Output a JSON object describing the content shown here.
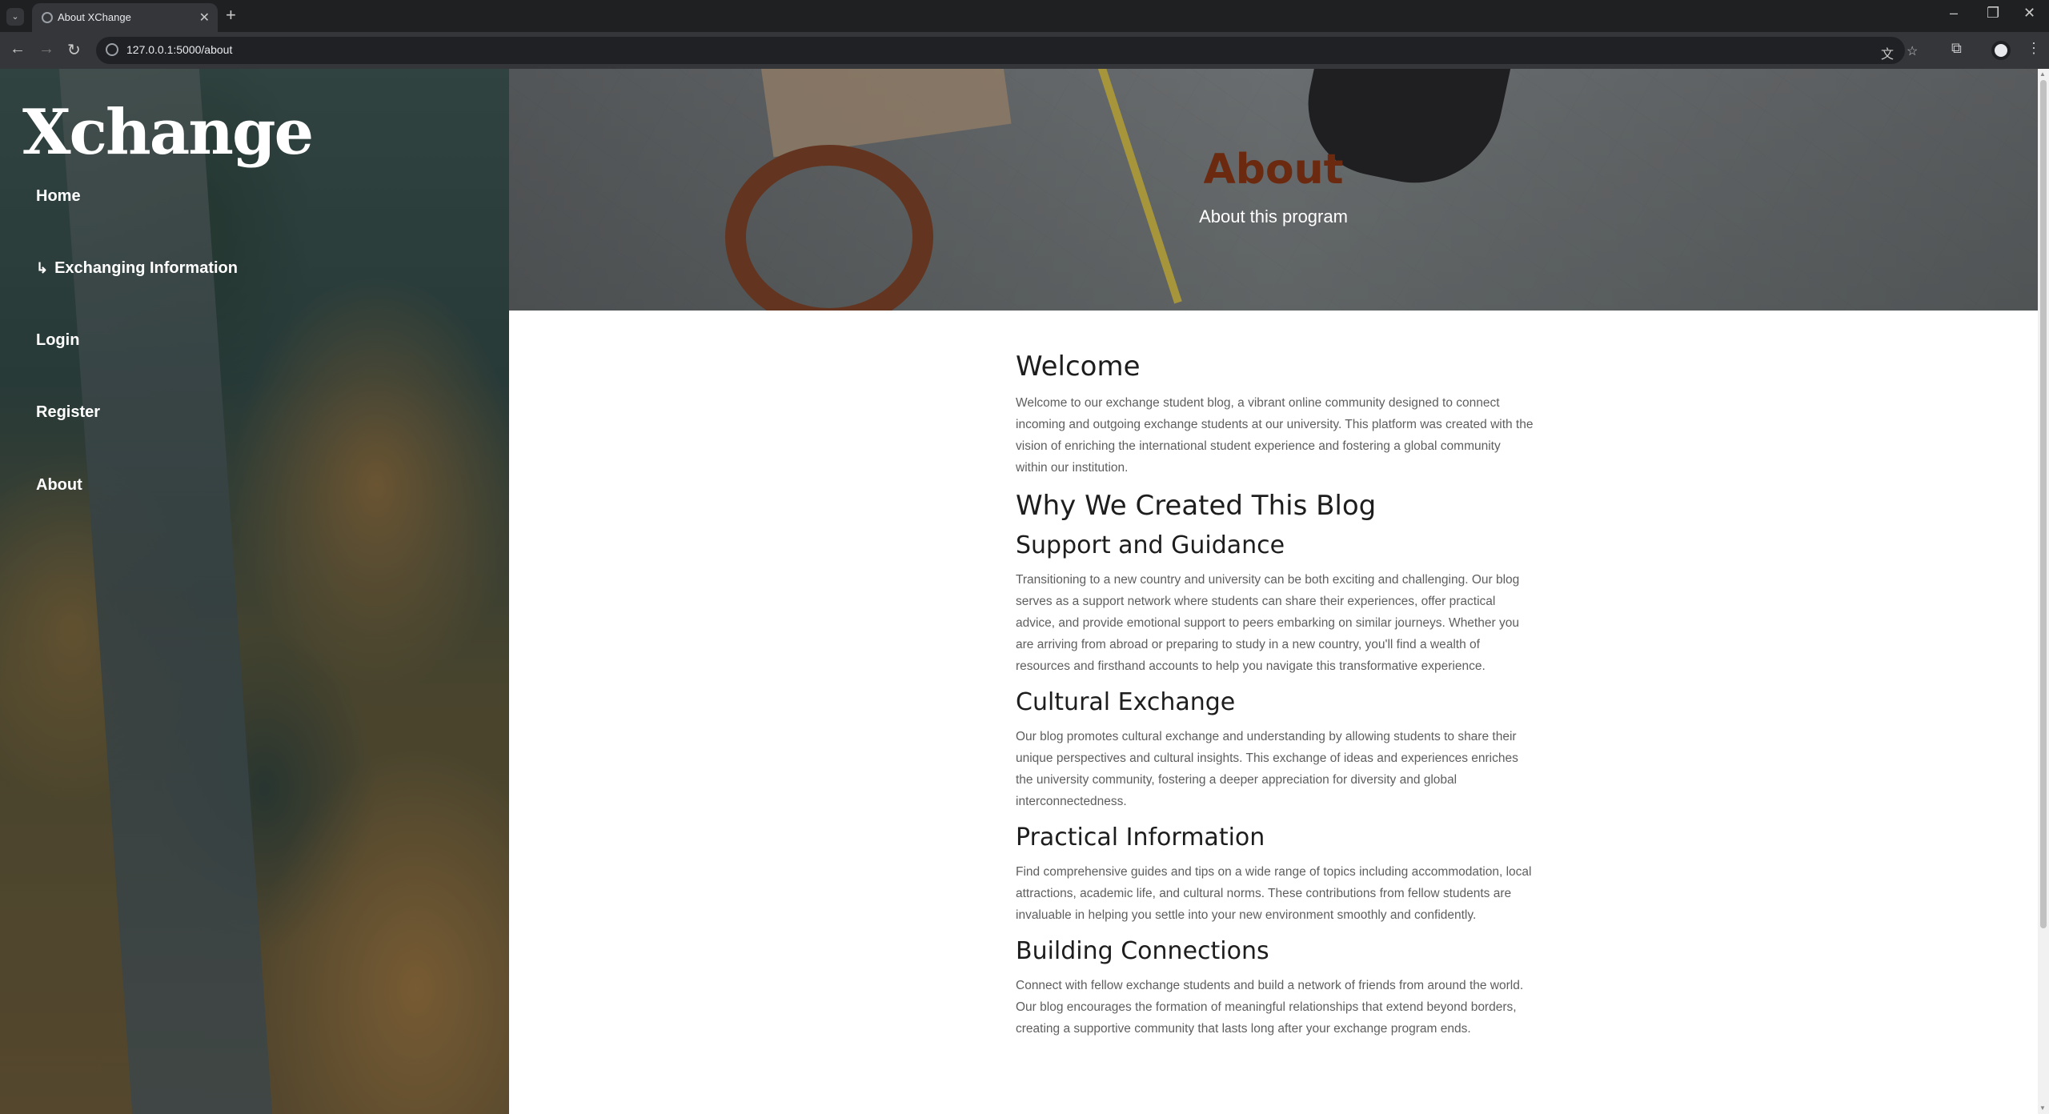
{
  "browser": {
    "tab_title": "About XChange",
    "url": "127.0.0.1:5000/about",
    "tab_close": "✕",
    "new_tab": "+",
    "tab_menu": "⌄"
  },
  "sidebar": {
    "logo": "Xchange",
    "items": [
      {
        "label": "Home"
      },
      {
        "label": "Exchanging Information",
        "prefix": "↳"
      },
      {
        "label": "Login"
      },
      {
        "label": "Register"
      },
      {
        "label": "About"
      }
    ]
  },
  "hero": {
    "title": "About",
    "subtitle": "About this program"
  },
  "content": {
    "welcome_heading": "Welcome",
    "welcome_text": "Welcome to our exchange student blog, a vibrant online community designed to connect incoming and outgoing exchange students at our university. This platform was created with the vision of enriching the international student experience and fostering a global community within our institution.",
    "why_heading": "Why We Created This Blog",
    "sections": [
      {
        "heading": "Support and Guidance",
        "text": "Transitioning to a new country and university can be both exciting and challenging. Our blog serves as a support network where students can share their experiences, offer practical advice, and provide emotional support to peers embarking on similar journeys. Whether you are arriving from abroad or preparing to study in a new country, you'll find a wealth of resources and firsthand accounts to help you navigate this transformative experience."
      },
      {
        "heading": "Cultural Exchange",
        "text": "Our blog promotes cultural exchange and understanding by allowing students to share their unique perspectives and cultural insights. This exchange of ideas and experiences enriches the university community, fostering a deeper appreciation for diversity and global interconnectedness."
      },
      {
        "heading": "Practical Information",
        "text": "Find comprehensive guides and tips on a wide range of topics including accommodation, local attractions, academic life, and cultural norms. These contributions from fellow students are invaluable in helping you settle into your new environment smoothly and confidently."
      },
      {
        "heading": "Building Connections",
        "text": "Connect with fellow exchange students and build a network of friends from around the world. Our blog encourages the formation of meaningful relationships that extend beyond borders, creating a supportive community that lasts long after your exchange program ends."
      }
    ]
  },
  "colors": {
    "hero_title": "#6b2a10",
    "sidebar_text": "#ffffff",
    "body_text": "#5e5e5e",
    "heading_text": "#1d1d1d"
  }
}
